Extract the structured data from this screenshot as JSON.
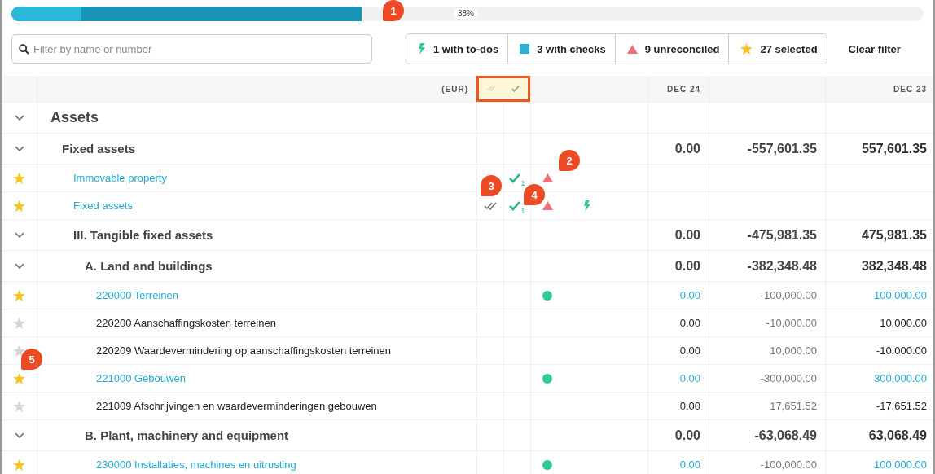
{
  "progress": {
    "level": 0.384,
    "done": {
      "level": 0.077
    },
    "label": "38%"
  },
  "search": {
    "placeholder": "Filter by name or number"
  },
  "filters": [
    {
      "kind": "todo",
      "label": "1 with to-dos"
    },
    {
      "kind": "checks",
      "label": "3 with checks"
    },
    {
      "kind": "unreconciled",
      "label": "9 unreconciled"
    },
    {
      "kind": "selected",
      "label": "27 selected"
    }
  ],
  "clear_filter": "Clear filter",
  "header": {
    "currency": "(EUR)",
    "col_1": "DEC 24",
    "col_3": "DEC 23"
  },
  "rows": [
    {
      "kind": "group",
      "name": "Assets",
      "expanded": true,
      "children": [
        {
          "kind": "group",
          "name": "Fixed assets",
          "expanded": true,
          "values": [
            "0.00",
            "-557,601.35",
            "557,601.35"
          ],
          "children": [
            {
              "kind": "account",
              "name": "Immovable property",
              "starred": true,
              "linked": true,
              "checks": "1",
              "unreconciled": true
            },
            {
              "kind": "account",
              "name": "Fixed assets",
              "starred": true,
              "linked": true,
              "reviewed": true,
              "checks": "1",
              "unreconciled": true,
              "todo": true
            },
            {
              "kind": "group",
              "name": "III. Tangible fixed assets",
              "expanded": true,
              "values": [
                "0.00",
                "-475,981.35",
                "475,981.35"
              ],
              "children": [
                {
                  "kind": "group",
                  "name": "A. Land and buildings",
                  "expanded": true,
                  "values": [
                    "0.00",
                    "-382,348.48",
                    "382,348.48"
                  ],
                  "children": [
                    {
                      "kind": "account",
                      "name": "220000 Terreinen",
                      "starred": true,
                      "linked": true,
                      "dot": true,
                      "values": [
                        "0.00",
                        "-100,000.00",
                        "100,000.00"
                      ]
                    },
                    {
                      "kind": "account",
                      "name": "220200 Aanschaffingskosten terreinen",
                      "starred": false,
                      "linked": false,
                      "values": [
                        "0.00",
                        "-10,000.00",
                        "10,000.00"
                      ]
                    },
                    {
                      "kind": "account",
                      "name": "220209 Waardevermindering op aanschaffingskosten terreinen",
                      "starred": false,
                      "linked": false,
                      "values": [
                        "0.00",
                        "10,000.00",
                        "-10,000.00"
                      ]
                    },
                    {
                      "kind": "account",
                      "name": "221000 Gebouwen",
                      "starred": true,
                      "linked": true,
                      "dot": true,
                      "values": [
                        "0.00",
                        "-300,000.00",
                        "300,000.00"
                      ]
                    },
                    {
                      "kind": "account",
                      "name": "221009 Afschrijvingen en waardeverminderingen gebouwen",
                      "starred": false,
                      "linked": false,
                      "values": [
                        "0.00",
                        "17,651.52",
                        "-17,651.52"
                      ]
                    }
                  ]
                },
                {
                  "kind": "group",
                  "name": "B. Plant, machinery and equipment",
                  "expanded": true,
                  "values": [
                    "0.00",
                    "-63,068.49",
                    "63,068.49"
                  ],
                  "children": [
                    {
                      "kind": "account",
                      "name": "230000 Installaties, machines en uitrusting",
                      "starred": true,
                      "linked": true,
                      "dot": true,
                      "values": [
                        "0.00",
                        "-100,000.00",
                        "100,000.00"
                      ]
                    }
                  ]
                }
              ]
            }
          ]
        }
      ]
    }
  ],
  "callouts": [
    {
      "label": "1"
    },
    {
      "label": "2"
    },
    {
      "label": "3"
    },
    {
      "label": "4"
    },
    {
      "label": "5"
    }
  ]
}
